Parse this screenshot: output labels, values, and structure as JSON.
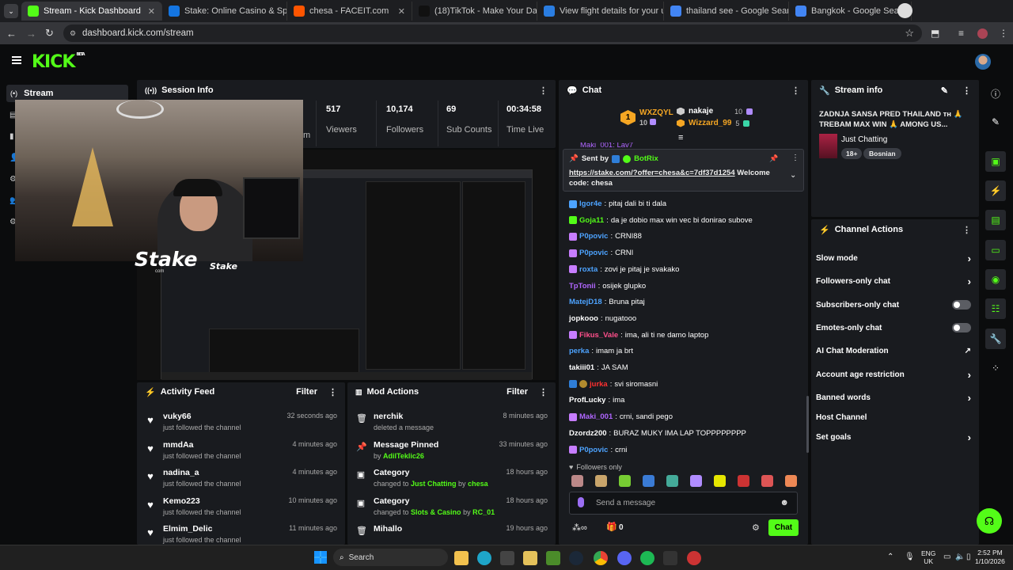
{
  "browser": {
    "tabs": [
      {
        "label": "Stream - Kick Dashboard",
        "color": "#53fc18"
      },
      {
        "label": "Stake: Online Casino & Sports",
        "color": "#1475e1"
      },
      {
        "label": "chesa - FACEIT.com",
        "color": "#ff5500"
      },
      {
        "label": "(18)TikTok - Make Your Day",
        "color": "#111111"
      },
      {
        "label": "View flight details for your upc",
        "color": "#2a7de1"
      },
      {
        "label": "thailand see - Google Search",
        "color": "#4285f4"
      },
      {
        "label": "Bangkok - Google Search",
        "color": "#4285f4"
      }
    ],
    "url": "dashboard.kick.com/stream"
  },
  "header": {
    "logo": "KICK",
    "logo_sup": "BETA"
  },
  "sidebar": {
    "active": "Stream"
  },
  "session": {
    "title": "Session Info",
    "partial_label": "m",
    "stats": [
      {
        "value": "517",
        "label": "Viewers"
      },
      {
        "value": "10,174",
        "label": "Followers"
      },
      {
        "value": "69",
        "label": "Sub Counts"
      },
      {
        "value": "00:34:58",
        "label": "Time Live"
      }
    ]
  },
  "overlay": {
    "brand1": "Stake",
    "brand1_sub": "com",
    "brand2": "Stake"
  },
  "activity": {
    "title": "Activity Feed",
    "filter": "Filter",
    "items": [
      {
        "name": "vuky66",
        "sub": "just followed the channel",
        "time": "32 seconds ago"
      },
      {
        "name": "mmdAa",
        "sub": "just followed the channel",
        "time": "4 minutes ago"
      },
      {
        "name": "nadina_a",
        "sub": "just followed the channel",
        "time": "4 minutes ago"
      },
      {
        "name": "Kemo223",
        "sub": "just followed the channel",
        "time": "10 minutes ago"
      },
      {
        "name": "Elmim_Delic",
        "sub": "just followed the channel",
        "time": "11 minutes ago"
      }
    ]
  },
  "mod": {
    "title": "Mod Actions",
    "filter": "Filter",
    "items": [
      {
        "name": "nerchik",
        "pre": "deleted a message",
        "hl": "",
        "mid": "",
        "by": "",
        "time": "8 minutes ago",
        "icon": "trash"
      },
      {
        "name": "Message Pinned",
        "pre": "by ",
        "hl": "AdilTeklic26",
        "mid": "",
        "by": "",
        "time": "33 minutes ago",
        "icon": "pin"
      },
      {
        "name": "Category",
        "pre": "changed to ",
        "hl": "Just Chatting",
        "mid": " by ",
        "by": "chesa",
        "time": "18 hours ago",
        "icon": "cat"
      },
      {
        "name": "Category",
        "pre": "changed to ",
        "hl": "Slots & Casino",
        "mid": " by ",
        "by": "RC_01",
        "time": "18 hours ago",
        "icon": "cat"
      },
      {
        "name": "Mihallo",
        "pre": "",
        "hl": "",
        "mid": "",
        "by": "",
        "time": "19 hours ago",
        "icon": "trash"
      }
    ]
  },
  "chat": {
    "title": "Chat",
    "top": [
      {
        "rank": "1",
        "name": "WXZQYL",
        "count": "10",
        "color": "#f5a623"
      },
      {
        "name": "nakaje",
        "count": "10",
        "color": "#ffffff"
      },
      {
        "name": "Wizzard_99",
        "count": "5",
        "color": "#f5a623"
      }
    ],
    "partial_msg": "Maki_001: Lav7",
    "pinned": {
      "sent_by": "Sent by",
      "bot": "BotRix",
      "link": "https://stake.com/?offer=chesa&c=7df37d1254",
      "text": " Welcome code: chesa"
    },
    "messages": [
      {
        "user": "Igor4e",
        "color": "#4da3ff",
        "text": "pitaj dali bi ti dala"
      },
      {
        "user": "Goja11",
        "color": "#53fc18",
        "text": "da je dobio max win vec bi donirao subove"
      },
      {
        "user": "P0povic",
        "color": "#4da3ff",
        "text": "CRNI88"
      },
      {
        "user": "P0povic",
        "color": "#4da3ff",
        "text": "CRNI"
      },
      {
        "user": "roxta",
        "color": "#4da3ff",
        "text": "zovi je pitaj je svakako"
      },
      {
        "user": "TpTonii",
        "color": "#b066ff",
        "text": "osijek glupko"
      },
      {
        "user": "MatejD18",
        "color": "#4da3ff",
        "text": "Bruna pitaj"
      },
      {
        "user": "jopkooo",
        "color": "#ffffff",
        "text": "nugatooo"
      },
      {
        "user": "Fikus_Vale",
        "color": "#ff4f8b",
        "text": "ima, ali ti ne damo laptop"
      },
      {
        "user": "perka",
        "color": "#4da3ff",
        "text": "imam ja brt"
      },
      {
        "user": "takiii01",
        "color": "#ffffff",
        "text": "JA SAM"
      },
      {
        "user": "jurka",
        "color": "#ff3030",
        "text": "svi siromasni"
      },
      {
        "user": "ProfLucky",
        "color": "#ffffff",
        "text": "ima"
      },
      {
        "user": "Maki_001",
        "color": "#b066ff",
        "text": "crni, sandi pego"
      },
      {
        "user": "Dzordz200",
        "color": "#ffffff",
        "text": "BURAZ MUKY IMA LAP TOPPPPPPPP"
      },
      {
        "user": "P0povic",
        "color": "#4da3ff",
        "text": "crni"
      }
    ],
    "followers_only": "Followers only",
    "placeholder": "Send a message",
    "count": "0",
    "send": "Chat"
  },
  "stream_info": {
    "title": "Stream info",
    "headline": "ZADNJA SANSA PRED THAILAND ᴛʜ 🙏 TREBAM MAX WIN 🙏 AMONG US...",
    "category": "Just Chatting",
    "tags": [
      "18+",
      "Bosnian"
    ]
  },
  "channel_actions": {
    "title": "Channel Actions",
    "items": [
      {
        "label": "Slow mode",
        "type": "chev"
      },
      {
        "label": "Followers-only chat",
        "type": "chev"
      },
      {
        "label": "Subscribers-only chat",
        "type": "toggle"
      },
      {
        "label": "Emotes-only chat",
        "type": "toggle"
      },
      {
        "label": "AI Chat Moderation",
        "type": "ext"
      },
      {
        "label": "Account age restriction",
        "type": "chev"
      },
      {
        "label": "Banned words",
        "type": "chev"
      },
      {
        "label": "Host Channel",
        "type": "none"
      },
      {
        "label": "Set goals",
        "type": "chev"
      }
    ]
  },
  "taskbar": {
    "search": "Search",
    "lang1": "ENG",
    "lang2": "UK",
    "time": "2:52 PM",
    "date": "1/10/2026"
  }
}
